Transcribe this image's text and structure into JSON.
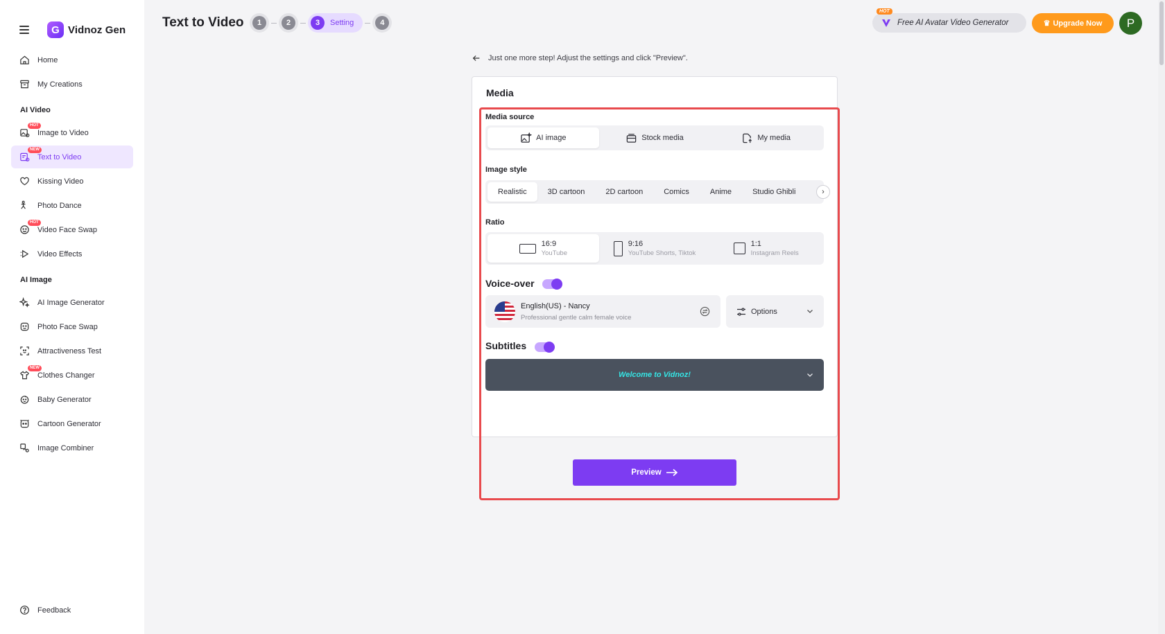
{
  "brand": {
    "name": "Vidnoz Gen",
    "logo_letter": "G"
  },
  "sidebar": {
    "top_items": [
      {
        "label": "Home",
        "icon": "home-icon"
      },
      {
        "label": "My Creations",
        "icon": "archive-icon"
      }
    ],
    "sections": [
      {
        "label": "AI Video",
        "items": [
          {
            "label": "Image to Video",
            "badge": "HOT",
            "icon": "image-video-icon"
          },
          {
            "label": "Text to Video",
            "badge": "NEW",
            "icon": "text-video-icon",
            "active": true
          },
          {
            "label": "Kissing Video",
            "badge": "",
            "icon": "kissing-icon"
          },
          {
            "label": "Photo Dance",
            "badge": "",
            "icon": "dance-icon"
          },
          {
            "label": "Video Face Swap",
            "badge": "HOT",
            "icon": "face-swap-icon"
          },
          {
            "label": "Video Effects",
            "badge": "",
            "icon": "effects-icon"
          }
        ]
      },
      {
        "label": "AI Image",
        "items": [
          {
            "label": "AI Image Generator",
            "badge": "",
            "icon": "sparkle-icon"
          },
          {
            "label": "Photo Face Swap",
            "badge": "",
            "icon": "face-icon"
          },
          {
            "label": "Attractiveness Test",
            "badge": "",
            "icon": "scan-face-icon"
          },
          {
            "label": "Clothes Changer",
            "badge": "NEW",
            "icon": "shirt-icon"
          },
          {
            "label": "Baby Generator",
            "badge": "",
            "icon": "baby-icon"
          },
          {
            "label": "Cartoon Generator",
            "badge": "",
            "icon": "cartoon-icon"
          },
          {
            "label": "Image Combiner",
            "badge": "",
            "icon": "combine-icon"
          }
        ]
      }
    ],
    "feedback": "Feedback"
  },
  "header": {
    "title": "Text to Video",
    "steps": [
      {
        "num": "1",
        "label": ""
      },
      {
        "num": "2",
        "label": ""
      },
      {
        "num": "3",
        "label": "Setting",
        "active": true
      },
      {
        "num": "4",
        "label": ""
      }
    ],
    "promo_badge": "HOT",
    "promo_text": "Free AI Avatar Video Generator",
    "upgrade_label": "Upgrade Now",
    "avatar_letter": "P"
  },
  "main": {
    "hint": "Just one more step! Adjust the settings and click \"Preview\".",
    "card_title": "Media",
    "media_source": {
      "label": "Media source",
      "options": [
        "AI image",
        "Stock media",
        "My media"
      ],
      "selected": "AI image"
    },
    "image_style": {
      "label": "Image style",
      "options": [
        "Realistic",
        "3D cartoon",
        "2D cartoon",
        "Comics",
        "Anime",
        "Studio Ghibli"
      ],
      "selected": "Realistic"
    },
    "ratio": {
      "label": "Ratio",
      "options": [
        {
          "ratio": "16:9",
          "sub": "YouTube"
        },
        {
          "ratio": "9:16",
          "sub": "YouTube Shorts, Tiktok"
        },
        {
          "ratio": "1:1",
          "sub": "Instagram Reels"
        }
      ],
      "selected": "16:9"
    },
    "voice_over": {
      "label": "Voice-over",
      "enabled": true,
      "voice_name": "English(US) - Nancy",
      "voice_desc": "Professional gentle calm female voice",
      "options_label": "Options"
    },
    "subtitles": {
      "label": "Subtitles",
      "enabled": true,
      "sample": "Welcome to Vidnoz!"
    },
    "preview_label": "Preview"
  },
  "colors": {
    "accent": "#7d3cf2",
    "upgrade": "#ff9a1c",
    "highlight_outline": "#e84a4d",
    "subtitle_text": "#35e6e6"
  }
}
